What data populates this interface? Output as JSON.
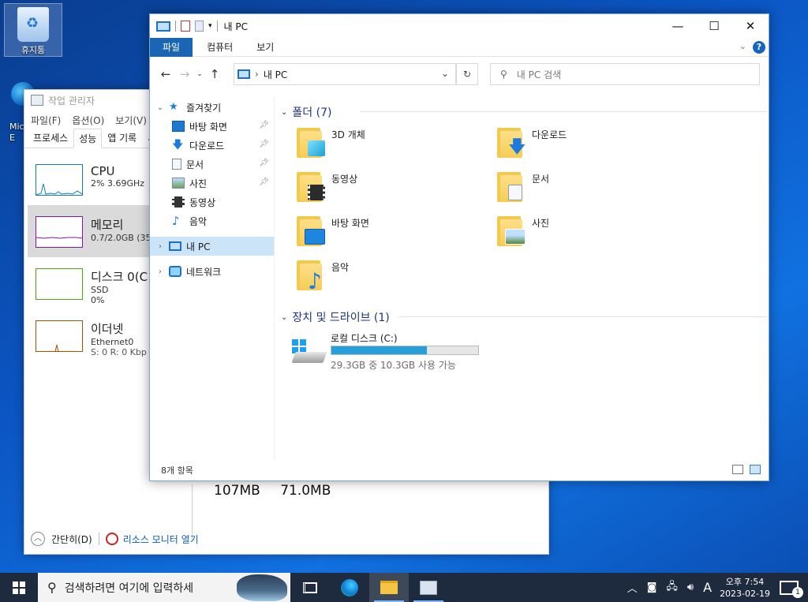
{
  "desktop": {
    "recycle_bin_label": "휴지통",
    "edge_label": "Mic E"
  },
  "task_manager": {
    "title": "작업 관리자",
    "menu": [
      "파일(F)",
      "옵션(O)",
      "보기(V)"
    ],
    "tabs": [
      "프로세스",
      "성능",
      "앱 기록",
      "시"
    ],
    "active_tab": "성능",
    "resources": [
      {
        "name": "CPU",
        "line1": "2% 3.69GHz",
        "line2": "",
        "color": "#117dbb"
      },
      {
        "name": "메모리",
        "line1": "0.7/2.0GB (35",
        "line2": "",
        "color": "#8b12ae"
      },
      {
        "name": "디스크 0(C",
        "line1": "SSD",
        "line2": "0%",
        "color": "#4da60c"
      },
      {
        "name": "이더넷",
        "line1": "Ethernet0",
        "line2": "S: 0 R: 0 Kbp",
        "color": "#a74f01"
      }
    ],
    "memory_values": [
      "107MB",
      "71.0MB"
    ],
    "footer": {
      "fewer_details": "간단히(D)",
      "resource_monitor": "리소스 모니터 열기"
    }
  },
  "explorer": {
    "title": "내 PC",
    "ribbon_tabs": [
      "파일",
      "컴퓨터",
      "보기"
    ],
    "address_path": "내 PC",
    "search_placeholder": "내 PC 검색",
    "nav": {
      "quick_access": "즐겨찾기",
      "items": [
        "바탕 화면",
        "다운로드",
        "문서",
        "사진",
        "동영상",
        "음악"
      ],
      "this_pc": "내 PC",
      "network": "네트워크"
    },
    "folders_header": "폴더 (7)",
    "folders": [
      "3D 개체",
      "다운로드",
      "동영상",
      "문서",
      "바탕 화면",
      "사진",
      "음악"
    ],
    "devices_header": "장치 및 드라이브 (1)",
    "drive": {
      "name": "로컬 디스크 (C:)",
      "size_text": "29.3GB 중 10.3GB 사용 가능",
      "used_fraction": 0.65
    },
    "status": "8개 항목"
  },
  "taskbar": {
    "search_placeholder": "검색하려면 여기에 입력하세",
    "time": "오후 7:54",
    "date": "2023-02-19",
    "ime": "A",
    "notification_count": "1"
  },
  "colors": {
    "accent": "#1a65b4",
    "selection": "#cce4f7",
    "drive_fill": "#26a0da"
  }
}
